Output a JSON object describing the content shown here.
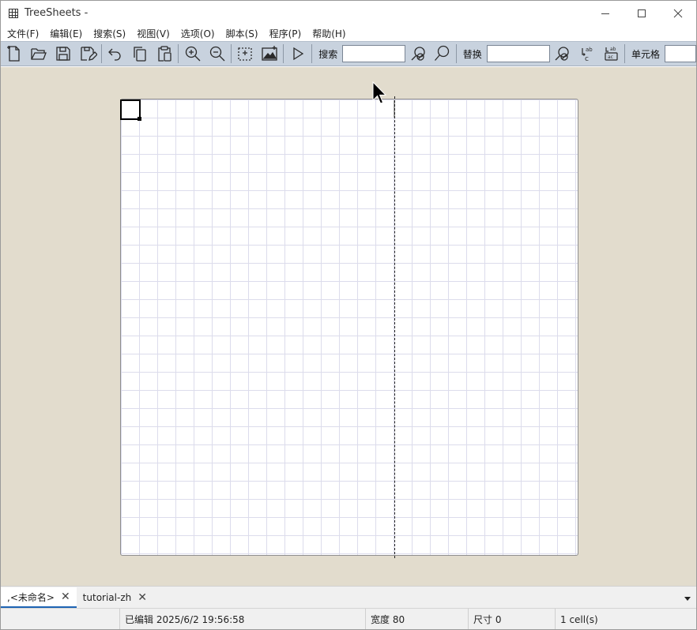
{
  "window": {
    "title": "TreeSheets -",
    "icons": {
      "app": "grid-app-icon",
      "minimize": "minimize-icon",
      "maximize": "maximize-icon",
      "close": "close-icon"
    }
  },
  "menu": {
    "items": [
      "文件(F)",
      "编辑(E)",
      "搜索(S)",
      "视图(V)",
      "选项(O)",
      "脚本(S)",
      "程序(P)",
      "帮助(H)"
    ]
  },
  "toolbar": {
    "search_label": "搜索",
    "search_value": "",
    "replace_label": "替换",
    "replace_value": "",
    "cell_label": "单元格",
    "cell_value": "",
    "icons": [
      "new-file-icon",
      "open-folder-icon",
      "save-icon",
      "save-as-icon",
      "undo-icon",
      "copy-icon",
      "paste-icon",
      "zoom-in-icon",
      "zoom-out-icon",
      "new-grid-icon",
      "insert-image-icon",
      "run-icon",
      "clear-search-icon",
      "search-icon",
      "clear-replace-icon",
      "replace-icon",
      "replace-all-icon"
    ]
  },
  "tabs": [
    {
      "label": ",<未命名>",
      "active": true
    },
    {
      "label": "tutorial-zh",
      "active": false
    }
  ],
  "tab_close_glyph": "✕",
  "status": {
    "edited": "已编辑 2025/6/2 19:56:58",
    "width": "宽度 80",
    "size": "尺寸 0",
    "cells": "1 cell(s)"
  },
  "colors": {
    "workspace_bg": "#e2dccd",
    "toolbar_bg": "#c8d2de",
    "grid_line": "#dcdcec",
    "active_tab_underline": "#1e64b4"
  }
}
